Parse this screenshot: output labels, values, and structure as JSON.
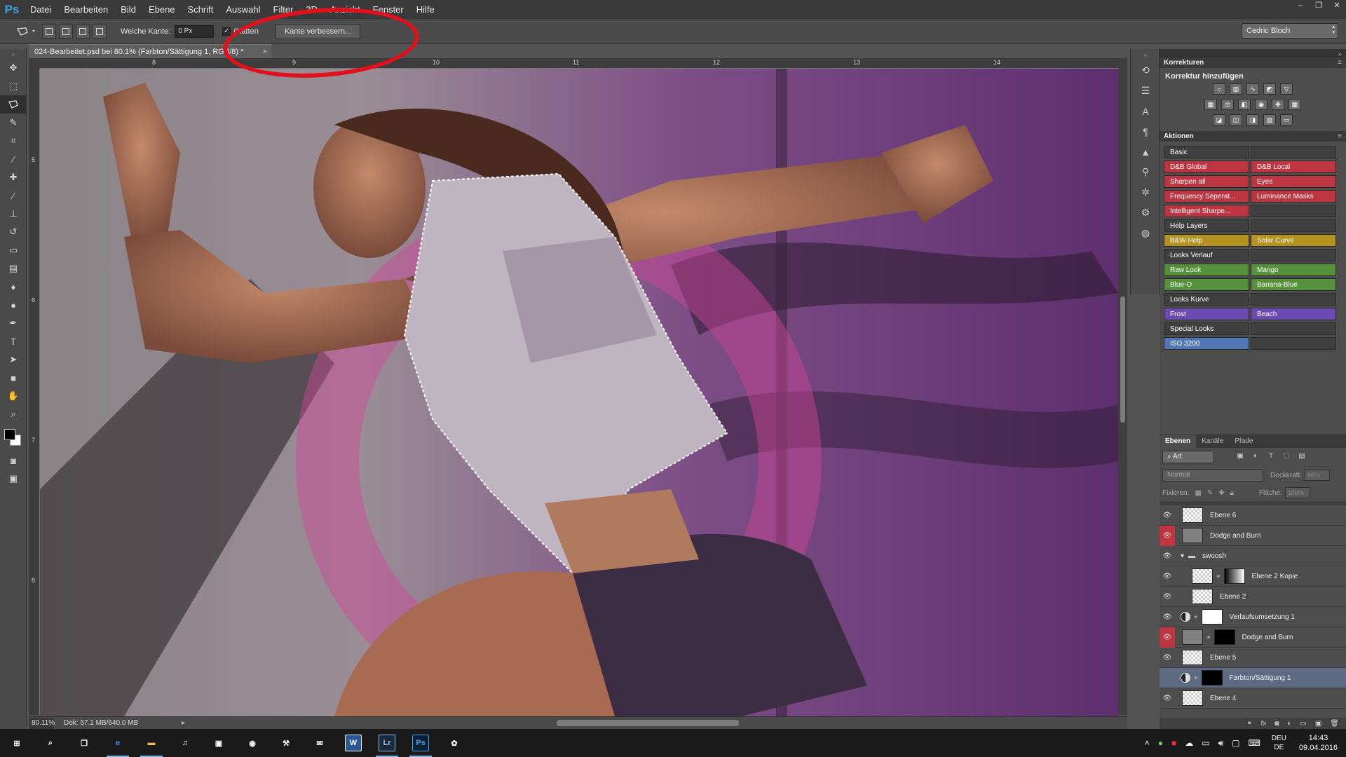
{
  "app": {
    "logo": "Ps"
  },
  "menu": [
    "Datei",
    "Bearbeiten",
    "Bild",
    "Ebene",
    "Schrift",
    "Auswahl",
    "Filter",
    "3D",
    "Ansicht",
    "Fenster",
    "Hilfe"
  ],
  "window_controls": [
    "–",
    "❐",
    "✕"
  ],
  "options": {
    "feather_label": "Weiche Kante:",
    "feather_value": "0 Px",
    "antialias_label": "Glätten",
    "refine_edge": "Kante verbessern...",
    "workspace": "Cedric Bloch"
  },
  "document": {
    "tab_title": "024-Bearbeitet.psd bei 80.1% (Farbton/Sättigung 1, RGB/8) *",
    "close": "×",
    "ruler_top": [
      "8",
      "9",
      "10",
      "11",
      "12",
      "13",
      "14"
    ],
    "ruler_left": [
      "5",
      "6",
      "7",
      "8"
    ]
  },
  "status": {
    "zoom": "80.11%",
    "doc_size": "Dok: 57.1 MB/640.0 MB"
  },
  "panels": {
    "corrections_tab": "Korrekturen",
    "corrections_subtitle": "Korrektur hinzufügen",
    "actions_tab": "Aktionen",
    "actions": [
      {
        "label": "Basic",
        "color": "gray"
      },
      {
        "label": "",
        "color": "gray"
      },
      {
        "label": "D&B Global",
        "color": "red"
      },
      {
        "label": "D&B Local",
        "color": "red"
      },
      {
        "label": "Sharpen all",
        "color": "red"
      },
      {
        "label": "Eyes",
        "color": "red"
      },
      {
        "label": "Frequency Seperat...",
        "color": "red"
      },
      {
        "label": "Luminance Masks",
        "color": "red"
      },
      {
        "label": "Intelligent Sharpe...",
        "color": "red"
      },
      {
        "label": "",
        "color": "gray"
      },
      {
        "label": "Help Layers",
        "color": "gray"
      },
      {
        "label": "",
        "color": "gray"
      },
      {
        "label": "B&W Help",
        "color": "yellow"
      },
      {
        "label": "Solar Curve",
        "color": "yellow"
      },
      {
        "label": "Looks Verlauf",
        "color": "gray"
      },
      {
        "label": "",
        "color": "gray"
      },
      {
        "label": "Raw Look",
        "color": "green"
      },
      {
        "label": "Mango",
        "color": "green"
      },
      {
        "label": "Blue-O",
        "color": "green"
      },
      {
        "label": "Banana-Blue",
        "color": "green"
      },
      {
        "label": "Looks Kurve",
        "color": "gray"
      },
      {
        "label": "",
        "color": "gray"
      },
      {
        "label": "Frost",
        "color": "violet"
      },
      {
        "label": "Beach",
        "color": "violet"
      },
      {
        "label": "Special Looks",
        "color": "gray"
      },
      {
        "label": "",
        "color": "gray"
      },
      {
        "label": "ISO 3200",
        "color": "blue"
      },
      {
        "label": "",
        "color": "gray"
      }
    ]
  },
  "layers": {
    "tabs": [
      "Ebenen",
      "Kanäle",
      "Pfade"
    ],
    "filter": "Art",
    "blend_mode": "Normal",
    "opacity_label": "Deckkraft:",
    "opacity": "96%",
    "lock_label": "Fixieren:",
    "fill_label": "Fläche:",
    "fill": "100%",
    "items": [
      {
        "name": "Ebene 6",
        "eye": "normal",
        "thumb": "checker",
        "mask": "",
        "indent": 0,
        "selected": false
      },
      {
        "name": "Dodge and Burn",
        "eye": "red",
        "thumb": "gray",
        "mask": "",
        "indent": 0,
        "selected": false
      },
      {
        "name": "swoosh",
        "eye": "normal",
        "thumb": "folder",
        "mask": "",
        "indent": 0,
        "selected": false
      },
      {
        "name": "Ebene 2 Kopie",
        "eye": "normal",
        "thumb": "checker",
        "mask": "gradient",
        "indent": 1,
        "selected": false
      },
      {
        "name": "Ebene 2",
        "eye": "normal",
        "thumb": "checker",
        "mask": "",
        "indent": 1,
        "selected": false
      },
      {
        "name": "Verlaufsumsetzung 1",
        "eye": "normal",
        "thumb": "adjust",
        "mask": "white",
        "indent": 0,
        "selected": false
      },
      {
        "name": "Dodge and Burn",
        "eye": "red",
        "thumb": "gray",
        "mask": "black",
        "indent": 0,
        "selected": false
      },
      {
        "name": "Ebene 5",
        "eye": "normal",
        "thumb": "checker",
        "mask": "",
        "indent": 0,
        "selected": false
      },
      {
        "name": "Farbton/Sättigung 1",
        "eye": "hidden",
        "thumb": "adjust",
        "mask": "black",
        "indent": 0,
        "selected": true
      },
      {
        "name": "Ebene 4",
        "eye": "normal",
        "thumb": "checker",
        "mask": "",
        "indent": 0,
        "selected": false
      }
    ]
  },
  "taskbar": {
    "apps": [
      {
        "name": "start",
        "glyph": "⊞",
        "active": false
      },
      {
        "name": "search",
        "glyph": "⌕",
        "active": false
      },
      {
        "name": "task-view",
        "glyph": "❐",
        "active": false
      },
      {
        "name": "edge",
        "glyph": "e",
        "active": true
      },
      {
        "name": "explorer",
        "glyph": "▬",
        "active": true
      },
      {
        "name": "itunes",
        "glyph": "♫",
        "active": false
      },
      {
        "name": "store",
        "glyph": "▣",
        "active": false
      },
      {
        "name": "steam",
        "glyph": "◉",
        "active": false
      },
      {
        "name": "tool",
        "glyph": "⚒",
        "active": false
      },
      {
        "name": "mail",
        "glyph": "✉",
        "active": false
      },
      {
        "name": "word",
        "glyph": "W",
        "active": false
      },
      {
        "name": "lightroom",
        "glyph": "Lr",
        "active": true
      },
      {
        "name": "photoshop",
        "glyph": "Ps",
        "active": true
      },
      {
        "name": "fan",
        "glyph": "✿",
        "active": false
      }
    ],
    "lang_top": "DEU",
    "lang_bottom": "DE",
    "time": "14:43",
    "date": "09.04.2016"
  }
}
